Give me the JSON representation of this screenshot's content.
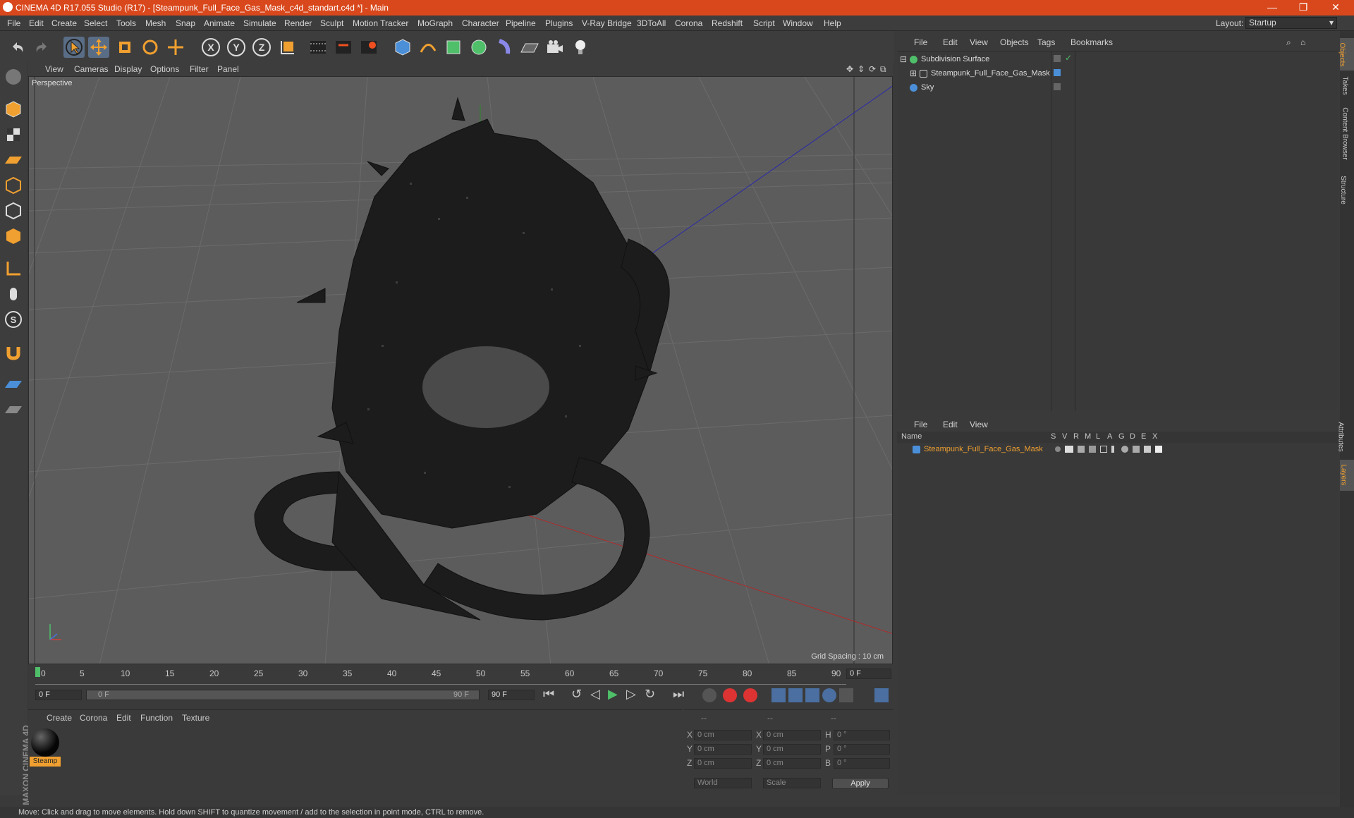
{
  "title_bar": {
    "title": "CINEMA 4D R17.055 Studio (R17) - [Steampunk_Full_Face_Gas_Mask_c4d_standart.c4d *] - Main",
    "minimize": "—",
    "maximize": "❐",
    "close": "✕"
  },
  "menu": {
    "items": [
      "File",
      "Edit",
      "Create",
      "Select",
      "Tools",
      "Mesh",
      "Snap",
      "Animate",
      "Simulate",
      "Render",
      "Sculpt",
      "Motion Tracker",
      "MoGraph",
      "Character",
      "Pipeline",
      "Plugins",
      "V-Ray Bridge",
      "3DToAll",
      "Corona",
      "Redshift",
      "Script",
      "Window",
      "Help"
    ],
    "layout_label": "Layout:",
    "layout_value": "Startup"
  },
  "viewport": {
    "menu": [
      "View",
      "Cameras",
      "Display",
      "Options",
      "Filter",
      "Panel"
    ],
    "label": "Perspective",
    "grid_spacing": "Grid Spacing : 10 cm"
  },
  "timeline": {
    "ticks": [
      "0",
      "5",
      "10",
      "15",
      "20",
      "25",
      "30",
      "35",
      "40",
      "45",
      "50",
      "55",
      "60",
      "65",
      "70",
      "75",
      "80",
      "85",
      "90"
    ],
    "current_frame": "0 F",
    "start_field": "0 F",
    "range_start": "0 F",
    "range_end": "90 F",
    "end_field": "90 F"
  },
  "material_panel": {
    "menu": [
      "Create",
      "Corona",
      "Edit",
      "Function",
      "Texture"
    ],
    "material_name": "Steamp"
  },
  "coords": {
    "headers": [
      "--",
      "--",
      "--"
    ],
    "rows": [
      {
        "a": "X",
        "av": "0 cm",
        "b": "X",
        "bv": "0 cm",
        "c": "H",
        "cv": "0 °"
      },
      {
        "a": "Y",
        "av": "0 cm",
        "b": "Y",
        "bv": "0 cm",
        "c": "P",
        "cv": "0 °"
      },
      {
        "a": "Z",
        "av": "0 cm",
        "b": "Z",
        "bv": "0 cm",
        "c": "B",
        "cv": "0 °"
      }
    ],
    "world": "World",
    "scale": "Scale",
    "apply": "Apply"
  },
  "object_manager": {
    "menu": [
      "File",
      "Edit",
      "View",
      "Objects",
      "Tags",
      "Bookmarks"
    ],
    "objects": [
      "Subdivision Surface",
      "Steampunk_Full_Face_Gas_Mask",
      "Sky"
    ]
  },
  "layer_manager": {
    "menu": [
      "File",
      "Edit",
      "View"
    ],
    "columns": [
      "Name",
      "S",
      "V",
      "R",
      "M",
      "L",
      "A",
      "G",
      "D",
      "E",
      "X"
    ],
    "layer": "Steampunk_Full_Face_Gas_Mask"
  },
  "side_tabs": [
    "Objects",
    "Takes",
    "Content Browser",
    "Structure",
    "Attributes",
    "Layers"
  ],
  "status": "Move: Click and drag to move elements. Hold down SHIFT to quantize movement / add to the selection in point mode, CTRL to remove.",
  "brand": "MAXON CINEMA 4D",
  "colors": {
    "title_bar": "#d9481c",
    "accent_orange": "#f0a030",
    "selection_blue": "#4a8fd8"
  }
}
